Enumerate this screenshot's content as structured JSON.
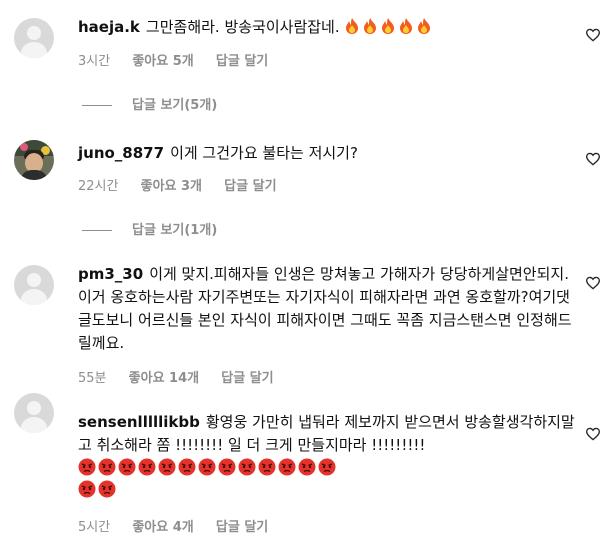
{
  "comments": [
    {
      "username": "haeja.k",
      "text": "그만좀해라. 방송국이사람잡네.",
      "emoji": [
        "fire",
        "fire",
        "fire",
        "fire",
        "fire"
      ],
      "time": "3시간",
      "likes": "좋아요 5개",
      "reply": "답글 달기",
      "view_replies": "답글 보기(5개)"
    },
    {
      "username": "juno_8877",
      "text": "이게 그건가요 불타는 저시기?",
      "time": "22시간",
      "likes": "좋아요 3개",
      "reply": "답글 달기",
      "view_replies": "답글 보기(1개)"
    },
    {
      "username": "pm3_30",
      "text": "이게 맞지.피해자들 인생은 망쳐놓고 가해자가 당당하게살면안되지. 이거 옹호하는사람 자기주변또는 자기자식이 피해자라면 과연 옹호할까?여기댓글도보니 어르신들 본인 자식이 피해자이면 그때도 꼭좀 지금스탠스면 인정해드릴께요.",
      "time": "55분",
      "likes": "좋아요 14개",
      "reply": "답글 달기"
    },
    {
      "username": "sensenlllllikbb",
      "text": "황영웅 가만히 냅둬라 제보까지 받으면서 방송할생각하지말고 취소해라 쫌 !!!!!!!! 일 더 크게 만들지마라 !!!!!!!!!",
      "emoji_row1_count": 13,
      "emoji_row2_count": 2,
      "emoji": "angry-face",
      "time": "5시간",
      "likes": "좋아요 4개",
      "reply": "답글 달기"
    }
  ],
  "icons": {
    "like": "heart-outline-icon",
    "fire": "fire-emoji",
    "angry": "angry-face-emoji"
  }
}
